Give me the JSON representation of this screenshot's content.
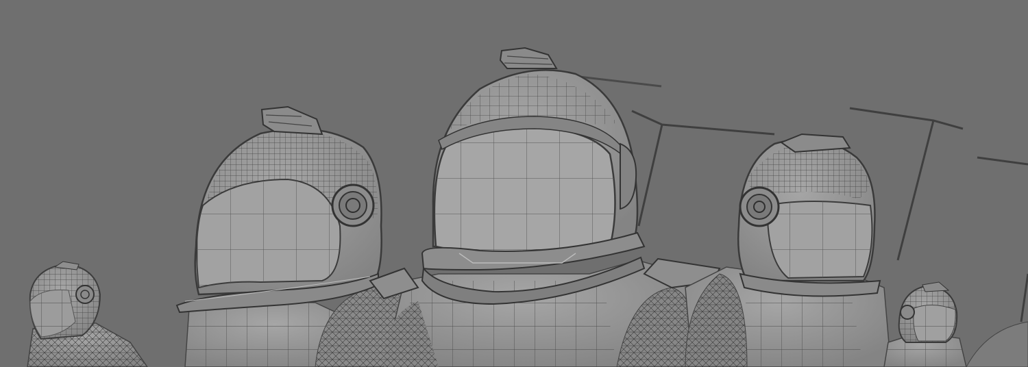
{
  "scene": {
    "description_colors": {
      "background": "#6f6f6f",
      "suit_fill": "#9a9a9a",
      "suit_shade": "#7e7e7e",
      "wire_line": "#3f3f3f",
      "highlight": "#bdbdbd"
    },
    "subjects": [
      {
        "name": "astronaut-far-left"
      },
      {
        "name": "astronaut-left"
      },
      {
        "name": "astronaut-center"
      },
      {
        "name": "astronaut-right"
      },
      {
        "name": "astronaut-far-right"
      }
    ]
  }
}
